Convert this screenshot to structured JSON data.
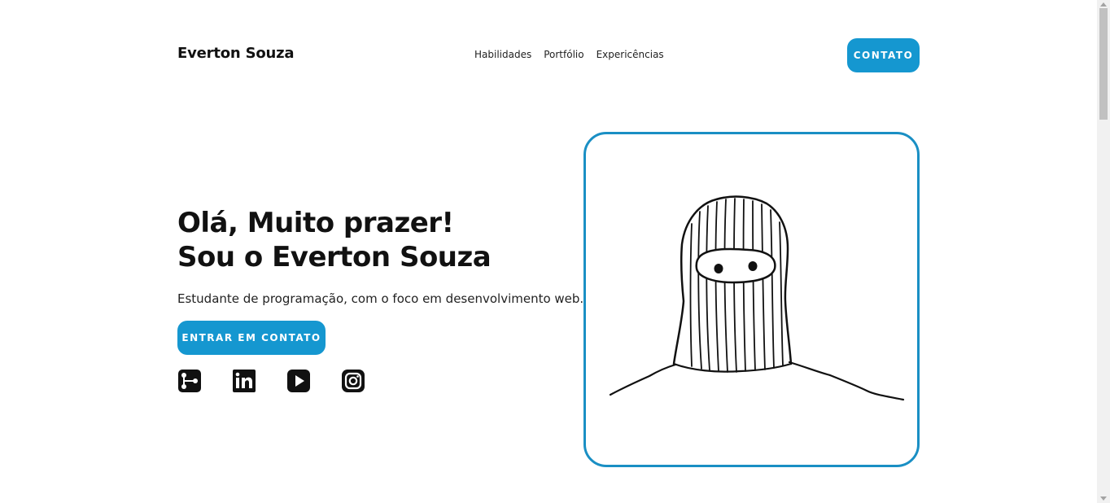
{
  "header": {
    "logo": "Everton Souza",
    "nav": [
      "Habilidades",
      "Portfólio",
      "Expericências"
    ],
    "contact_button": "CONTATO"
  },
  "hero": {
    "title_line1": "Olá, Muito prazer!",
    "title_line2": "Sou o Everton Souza",
    "subtitle": "Estudante de programação, com o foco em desenvolvimento web.",
    "cta_button": "ENTRAR EM CONTATO",
    "social_icons": [
      "graph-icon",
      "linkedin-icon",
      "youtube-icon",
      "instagram-icon"
    ]
  },
  "colors": {
    "accent": "#1597d0",
    "frame_border": "#1a8fc4",
    "text": "#111111",
    "background": "#ffffff"
  }
}
